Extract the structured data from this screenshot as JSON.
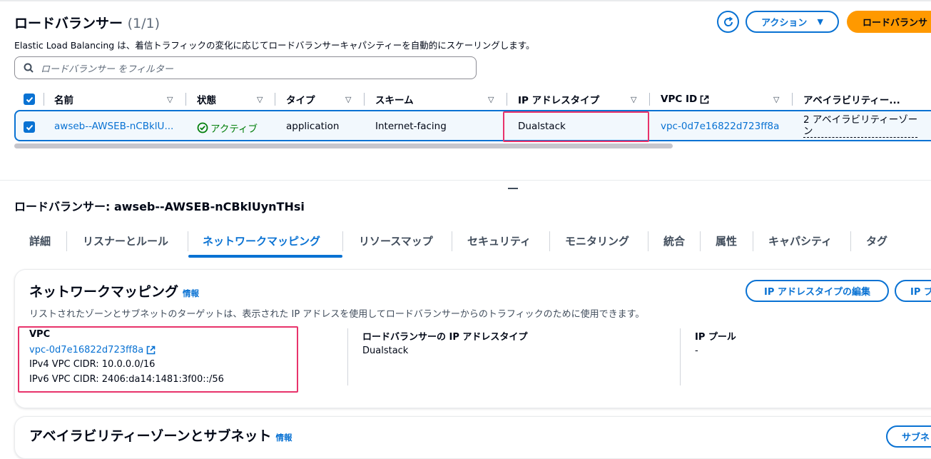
{
  "list": {
    "title": "ロードバランサー",
    "count": "(1/1)",
    "description": "Elastic Load Balancing は、着信トラフィックの変化に応じてロードバランサーキャパシティーを自動的にスケーリングします。",
    "actions_label": "アクション",
    "create_label": "ロードバランサ",
    "search_placeholder": "ロードバランサー をフィルター"
  },
  "table": {
    "columns": [
      {
        "label": "名前"
      },
      {
        "label": "状態"
      },
      {
        "label": "タイプ"
      },
      {
        "label": "スキーム"
      },
      {
        "label": "IP アドレスタイプ"
      },
      {
        "label": "VPC ID"
      },
      {
        "label": "アベイラビリティー..."
      }
    ],
    "row": {
      "name": "awseb--AWSEB-nCBklU...",
      "status": "アクティブ",
      "type": "application",
      "scheme": "Internet-facing",
      "ip_type": "Dualstack",
      "vpc_id": "vpc-0d7e16822d723ff8a",
      "az_line1": "2 アベイラビリティーゾー",
      "az_line2": "ン"
    }
  },
  "detail": {
    "title": "ロードバランサー: awseb--AWSEB-nCBklUynTHsi",
    "tabs": [
      {
        "label": "詳細"
      },
      {
        "label": "リスナーとルール"
      },
      {
        "label": "ネットワークマッピング"
      },
      {
        "label": "リソースマップ"
      },
      {
        "label": "セキュリティ"
      },
      {
        "label": "モニタリング"
      },
      {
        "label": "統合"
      },
      {
        "label": "属性"
      },
      {
        "label": "キャパシティ"
      },
      {
        "label": "タグ"
      }
    ],
    "active_tab": "ネットワークマッピング"
  },
  "network": {
    "title": "ネットワークマッピング",
    "info": "情報",
    "description": "リストされたゾーンとサブネットのターゲットは、表示された IP アドレスを使用してロードバランサーからのトラフィックのために使用できます。",
    "edit_ip_label": "IP アドレスタイプの編集",
    "ip_pool_btn_label": "IP プ",
    "vpc_label": "VPC",
    "vpc_id": "vpc-0d7e16822d723ff8a",
    "ipv4": "IPv4 VPC CIDR: 10.0.0.0/16",
    "ipv6": "IPv6 VPC CIDR: 2406:da14:1481:3f00::/56",
    "lb_ip_label": "ロードバランサーの IP アドレスタイプ",
    "lb_ip_value": "Dualstack",
    "ip_pool_label": "IP プール",
    "ip_pool_value": "-"
  },
  "az_section": {
    "title": "アベイラビリティーゾーンとサブネット",
    "info": "情報",
    "button_label": "サブネ"
  },
  "colors": {
    "accent": "#0972d3",
    "primary": "#ff9900",
    "success": "#037f0c",
    "highlight": "#e8336b"
  }
}
